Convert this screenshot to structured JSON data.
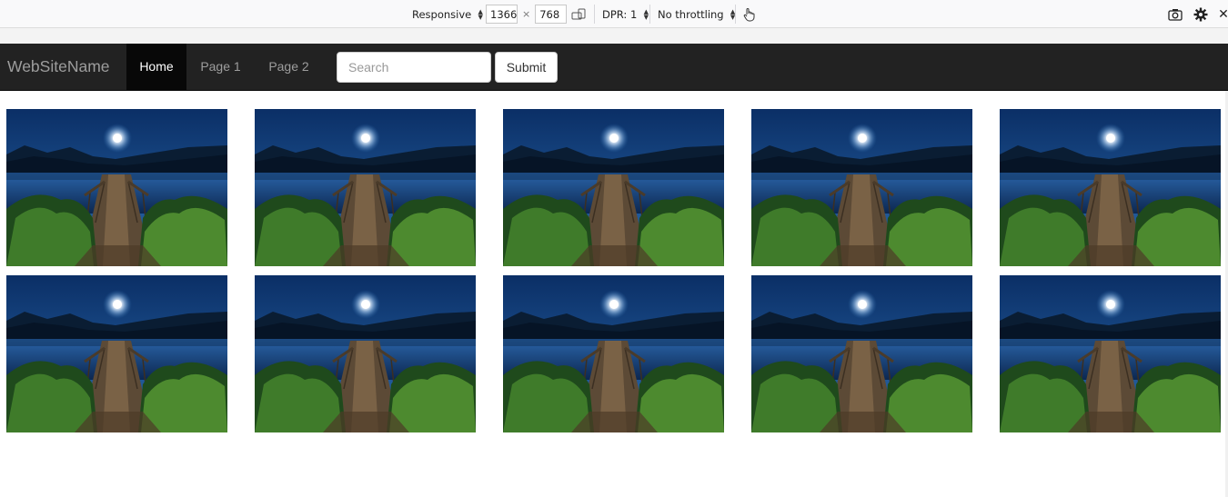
{
  "devtools": {
    "device_label": "Responsive",
    "width_value": "1366",
    "height_value": "768",
    "times_sign": "×",
    "dpr_label": "DPR: 1",
    "throttling_label": "No throttling",
    "close_glyph": "✕"
  },
  "site": {
    "brand": "WebSiteName",
    "nav": [
      {
        "label": "Home",
        "active": true
      },
      {
        "label": "Page 1",
        "active": false
      },
      {
        "label": "Page 2",
        "active": false
      }
    ],
    "search_placeholder": "Search",
    "submit_label": "Submit"
  },
  "gallery": {
    "rows": 2,
    "columns": 5,
    "image_subject": "moonlit-lake-pier-photo"
  },
  "colors": {
    "navbar_bg": "#222222",
    "nav_active_bg": "#080808",
    "nav_text": "#9d9d9d",
    "sky_top": "#0b2f66",
    "sky_bottom": "#2a6cb0"
  }
}
